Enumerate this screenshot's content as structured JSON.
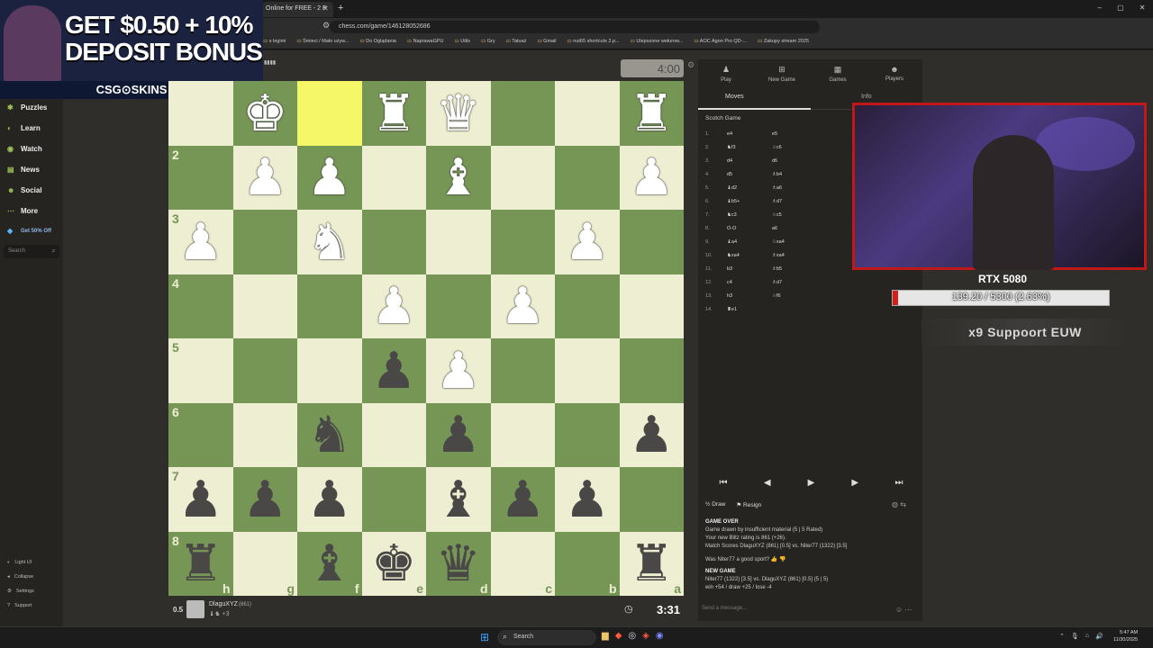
{
  "browser": {
    "tab_title": "Online for FREE - 2 P",
    "url": "chess.com/game/146128052686",
    "bookmarks": [
      "s legimi",
      "Śmieci / Mało używ...",
      "Do Oglądania",
      "NaprawaGPU",
      "Utils",
      "Gry",
      "Tatuaż",
      "Gmail",
      "nut65 shortcuts 2.p...",
      "Ulepszone wełurow...",
      "AOC Agon Pro QD-...",
      "Zakupy stream 2025"
    ]
  },
  "ad": {
    "line1": "GET $0.50 + 10%",
    "line2": "DEPOSIT BONUS",
    "brand": "CSG⊙SKINS"
  },
  "sidebar": {
    "items": [
      {
        "icon": "puzzle-icon",
        "label": "Puzzles"
      },
      {
        "icon": "learn-icon",
        "label": "Learn"
      },
      {
        "icon": "watch-icon",
        "label": "Watch"
      },
      {
        "icon": "news-icon",
        "label": "News"
      },
      {
        "icon": "social-icon",
        "label": "Social"
      },
      {
        "icon": "more-icon",
        "label": "More"
      }
    ],
    "promo": "Get 50% Off",
    "search_placeholder": "Search",
    "bottom": [
      "Light UI",
      "Collapse",
      "Settings",
      "Support"
    ]
  },
  "board": {
    "ranks": [
      "",
      "2",
      "3",
      "4",
      "5",
      "6",
      "7",
      "8"
    ],
    "files": [
      "h",
      "g",
      "f",
      "e",
      "d",
      "c",
      "b",
      "a"
    ],
    "highlight": [
      [
        0,
        2
      ]
    ],
    "pieces": [
      [
        "",
        "♚",
        "",
        "♜",
        "♛",
        "",
        "",
        "♜"
      ],
      [
        "",
        "♟",
        "♟",
        "",
        "♝",
        "",
        "",
        "♟"
      ],
      [
        "♟",
        "",
        "♞",
        "",
        "",
        "",
        "♟",
        ""
      ],
      [
        "",
        "",
        "",
        "♟",
        "",
        "♟",
        "",
        ""
      ],
      [
        "",
        "",
        "",
        "♟",
        "♟",
        "",
        "",
        ""
      ],
      [
        "",
        "",
        "♞",
        "",
        "♟",
        "",
        "",
        "♟"
      ],
      [
        "♟",
        "♟",
        "♟",
        "",
        "♝",
        "♟",
        "♟",
        ""
      ],
      [
        "♜",
        "",
        "♝",
        "♚",
        "♛",
        "",
        "",
        "♜"
      ]
    ],
    "colors": [
      [
        "w",
        "w",
        "w",
        "w",
        "w",
        "w",
        "w",
        "w"
      ],
      [
        "",
        "w",
        "w",
        "",
        "w",
        "",
        "",
        "w"
      ],
      [
        "w",
        "",
        "w",
        "",
        "",
        "",
        "w",
        ""
      ],
      [
        "",
        "",
        "",
        "w",
        "",
        "w",
        "",
        ""
      ],
      [
        "",
        "",
        "",
        "b",
        "w",
        "",
        "",
        ""
      ],
      [
        "",
        "",
        "b",
        "",
        "b",
        "",
        "",
        "b"
      ],
      [
        "b",
        "b",
        "b",
        "",
        "b",
        "b",
        "b",
        ""
      ],
      [
        "b",
        "",
        "b",
        "b",
        "b",
        "",
        "",
        "b"
      ]
    ]
  },
  "opponent": {
    "clock": "4:00"
  },
  "me": {
    "score": "0.5",
    "name": "DlaguXYZ",
    "rating": "(861)",
    "captures": "♝♞ +3",
    "clock": "3:31"
  },
  "panel": {
    "tabs": [
      {
        "icon": "play-icon",
        "label": "Play"
      },
      {
        "icon": "new-game-icon",
        "label": "New Game"
      },
      {
        "icon": "games-icon",
        "label": "Games"
      },
      {
        "icon": "players-icon",
        "label": "Players"
      }
    ],
    "subtab_moves": "Moves",
    "subtab_info": "Info",
    "opening": "Scotch Game",
    "moves": [
      {
        "n": "1.",
        "w": "e4",
        "b": "e5"
      },
      {
        "n": "2.",
        "w": "♞f3",
        "b": "♘c6"
      },
      {
        "n": "3.",
        "w": "d4",
        "b": "d6"
      },
      {
        "n": "4.",
        "w": "d5",
        "b": "♗b4"
      },
      {
        "n": "5.",
        "w": "♝d2",
        "b": "♗a6"
      },
      {
        "n": "6.",
        "w": "♝b5+",
        "b": "♗d7"
      },
      {
        "n": "7.",
        "w": "♞c3",
        "b": "♘c5"
      },
      {
        "n": "8.",
        "w": "O-O",
        "b": "a6"
      },
      {
        "n": "9.",
        "w": "♝a4",
        "b": "♘xa4"
      },
      {
        "n": "10.",
        "w": "♞xa4",
        "b": "♗xa4"
      },
      {
        "n": "11.",
        "w": "b3",
        "b": "♗b5"
      },
      {
        "n": "12.",
        "w": "c4",
        "b": "♗d7"
      },
      {
        "n": "13.",
        "w": "h3",
        "b": "♘f6"
      },
      {
        "n": "14.",
        "w": "♜e1",
        "b": ""
      }
    ],
    "nav": [
      "⏮",
      "◀",
      "▶",
      "▶",
      "⏭"
    ],
    "draw": "Draw",
    "resign": "Resign",
    "gameover_title": "GAME OVER",
    "gameover_lines": [
      "Game drawn by insufficient material (5 | 5 Rated)",
      "Your new Blitz rating is 861 (+26).",
      "Match Scores DlaguXYZ (861) [0.5] vs. Niter77 (1322) [3.5]"
    ],
    "sport": "Was Niter77 a good sport?",
    "newgame_title": "NEW GAME",
    "newgame_lines": [
      "Niter77 (1322) [3.5] vs. DlaguXYZ (861) [0.5] (5 | 5)",
      "win +54 / draw +25 / lose -4"
    ],
    "message_placeholder": "Send a message..."
  },
  "overlay": {
    "gpu_name": "RTX 5080",
    "gpu_text": "139.20 / 5300 (2.63%)",
    "gpu_progress": 0.0263,
    "rank_text": "x9 Suppoort   EUW"
  },
  "taskbar": {
    "search": "Search",
    "time": "5:47 AM",
    "date": "11/30/2025"
  }
}
